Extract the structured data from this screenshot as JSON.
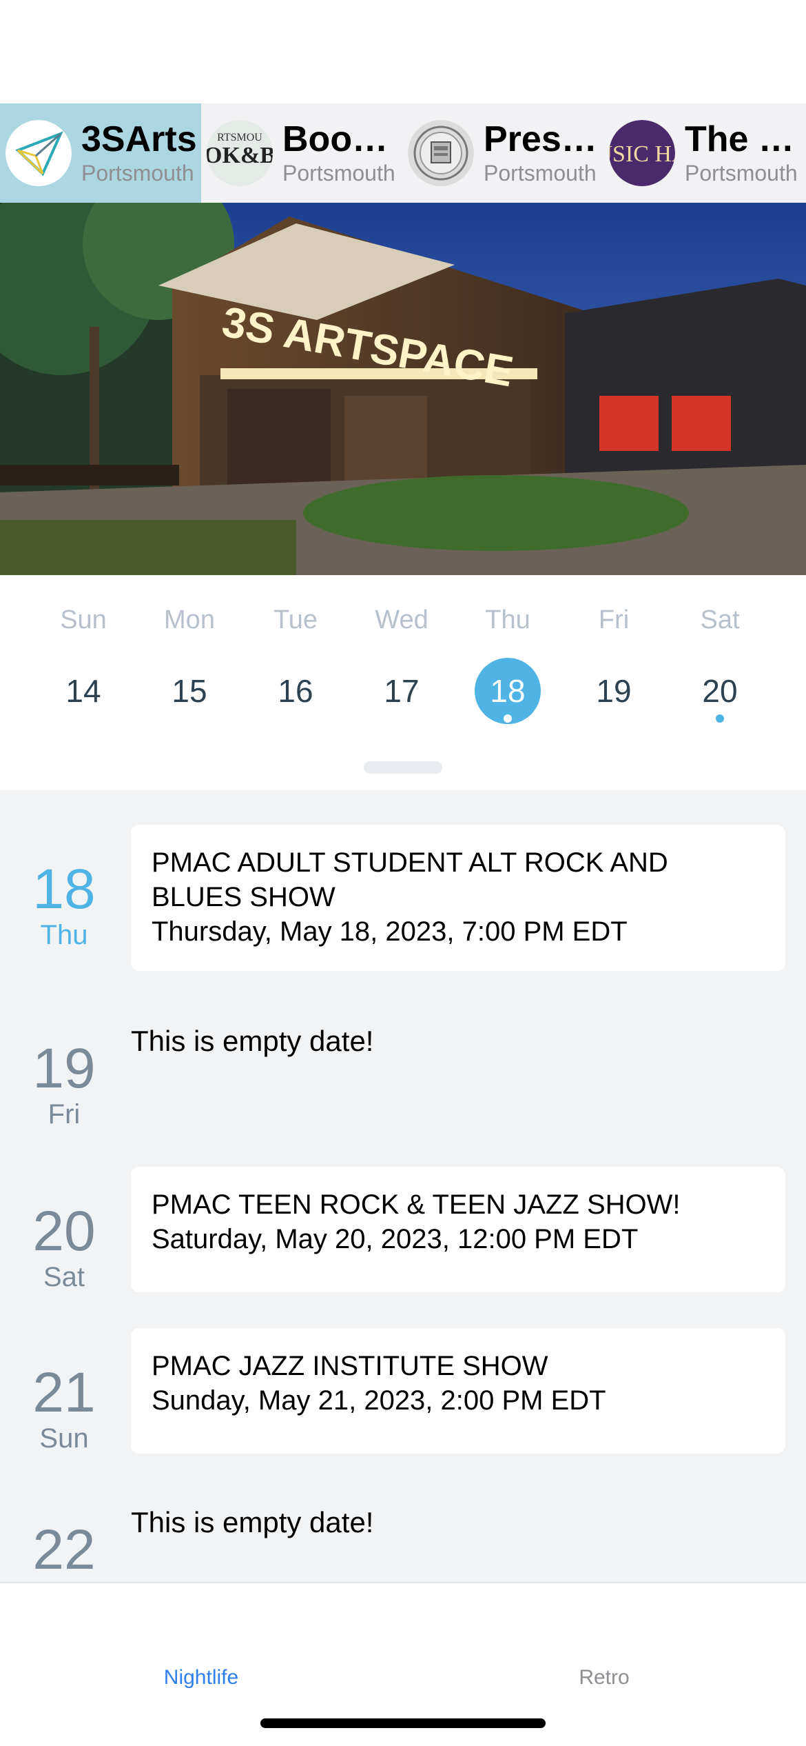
{
  "venues": [
    {
      "name": "3SArts",
      "city": "Portsmouth",
      "selected": true,
      "icon": "paper-plane-logo-icon"
    },
    {
      "name": "Book & Bar",
      "city": "Portsmouth",
      "selected": false,
      "icon": "book-and-bar-logo-icon",
      "logo_text_top": "RTSMOU",
      "logo_text_bottom": "OK&B"
    },
    {
      "name": "Press Room",
      "city": "Portsmouth",
      "selected": false,
      "icon": "press-room-logo-icon"
    },
    {
      "name": "The Music Hall",
      "city": "Portsmouth",
      "selected": false,
      "icon": "music-hall-logo-icon",
      "logo_text": "USIC HA"
    }
  ],
  "hero": {
    "sign_text": "3S ARTSPACE",
    "icon": "venue-photo"
  },
  "calendar": {
    "weekdays": [
      "Sun",
      "Mon",
      "Tue",
      "Wed",
      "Thu",
      "Fri",
      "Sat"
    ],
    "dates": [
      "14",
      "15",
      "16",
      "17",
      "18",
      "19",
      "20"
    ],
    "selected_index": 4,
    "marked_indices": [
      4,
      6
    ],
    "accent_color": "#4fb3e5"
  },
  "agenda": [
    {
      "day": "18",
      "weekday": "Thu",
      "today": true,
      "event": {
        "title": "PMAC ADULT STUDENT ALT ROCK AND BLUES SHOW",
        "when": "Thursday, May 18, 2023, 7:00 PM EDT"
      }
    },
    {
      "day": "19",
      "weekday": "Fri",
      "today": false,
      "empty": "This is empty date!"
    },
    {
      "day": "20",
      "weekday": "Sat",
      "today": false,
      "event": {
        "title": "PMAC TEEN ROCK & TEEN JAZZ SHOW!",
        "when": "Saturday, May 20, 2023, 12:00 PM EDT"
      }
    },
    {
      "day": "21",
      "weekday": "Sun",
      "today": false,
      "event": {
        "title": "PMAC JAZZ INSTITUTE SHOW",
        "when": "Sunday, May 21, 2023, 2:00 PM EDT"
      }
    },
    {
      "day": "22",
      "weekday": "",
      "today": false,
      "empty": "This is empty date!"
    }
  ],
  "tabs": [
    {
      "label": "Nightlife",
      "active": true,
      "color": "#2f80ed"
    },
    {
      "label": "Retro",
      "active": false,
      "color": "#8e8e93"
    }
  ]
}
